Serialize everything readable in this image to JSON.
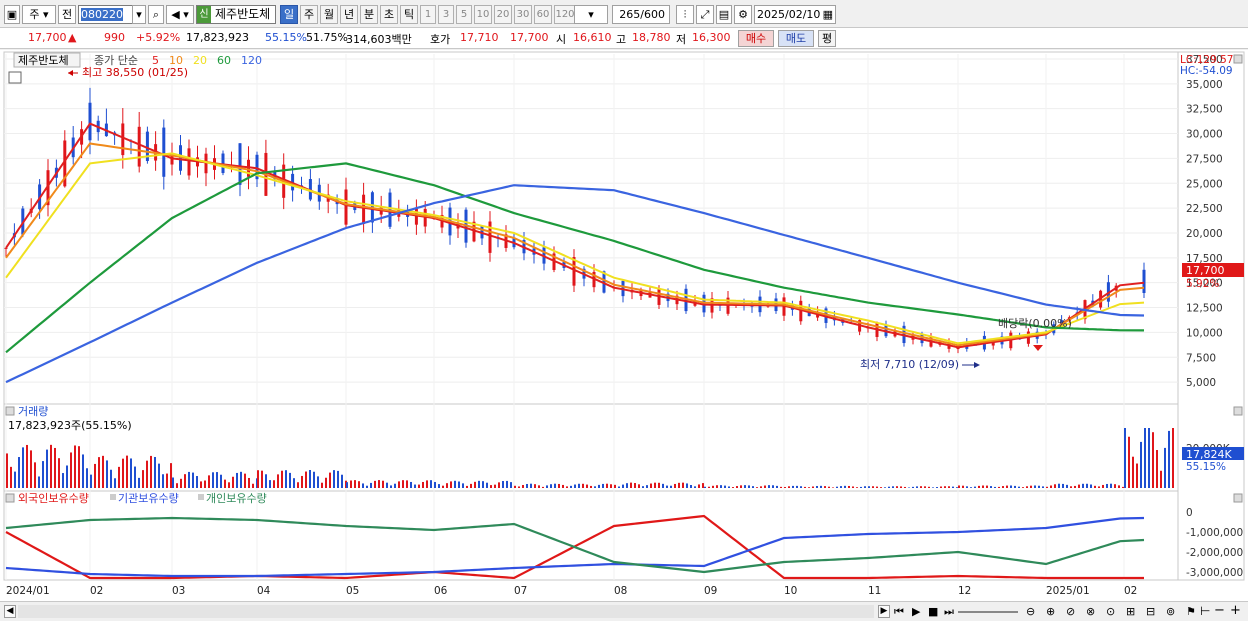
{
  "toolbar": {
    "market": "주",
    "prev": "전",
    "code": "080220",
    "new_badge": "신",
    "stock_name": "제주반도체",
    "periods": [
      "일",
      "주",
      "월",
      "년",
      "분",
      "초",
      "틱"
    ],
    "selected_period": "일",
    "intervals": [
      "1",
      "3",
      "5",
      "10",
      "20",
      "30",
      "60",
      "120"
    ],
    "count": "265",
    "count_total": "/600",
    "date": "2025/02/10"
  },
  "quote": {
    "price": "17,700",
    "change_arrow": "▲",
    "change": "990",
    "change_pct": "+5.92%",
    "volume": "17,823,923",
    "vol_ratio": "55.15%",
    "turnover": "51.75%",
    "amount": "314,603백만",
    "bid_label": "호가",
    "bid1": "17,710",
    "bid2": "17,700",
    "open_label": "시",
    "open": "16,610",
    "high_label": "고",
    "high": "18,780",
    "low_label": "저",
    "low": "16,300",
    "buy_label": "매수",
    "sell_label": "매도",
    "extra_label": "평"
  },
  "colors": {
    "up": "#e0161b",
    "down": "#1f4fd1",
    "ma5": "#e02020",
    "ma10": "#f08a1a",
    "ma20": "#f0e020",
    "ma60": "#1e9a3c",
    "ma120": "#3a64e0",
    "foreign": "#e01818",
    "institution": "#3050e0",
    "individual": "#2f8a5a"
  },
  "price_panel": {
    "title": "제주반도체",
    "legend_prefix": "종가 단순",
    "ma_labels": [
      "5",
      "10",
      "20",
      "60",
      "120"
    ],
    "lc_label": "LC:129.57",
    "hc_label": "HC:-54.09",
    "high_note": "최고 38,550 (01/25)",
    "low_note": "최저 7,710 (12/09)",
    "dividend_note": "배당락(0.00%)",
    "last_price_label": "17,700",
    "last_pct_label": "5.92%"
  },
  "volume_panel": {
    "title": "거래량",
    "value_label": "17,823,923주(55.15%)",
    "axis_label": "20,000K",
    "last_label": "17,824K",
    "last_pct": "55.15%"
  },
  "holdings_panel": {
    "labels": [
      "외국인보유수량",
      "기관보유수량",
      "개인보유수량"
    ]
  },
  "chart_data": [
    {
      "type": "line",
      "title": "제주반도체",
      "x": [
        "2024/01",
        "02",
        "03",
        "04",
        "05",
        "06",
        "07",
        "08",
        "09",
        "10",
        "11",
        "12",
        "2025/01",
        "02"
      ],
      "ylim": [
        3000,
        38000
      ],
      "yticks": [
        "5,000",
        "7,500",
        "10,000",
        "12,500",
        "15,000",
        "17,500",
        "20,000",
        "22,500",
        "25,000",
        "27,500",
        "30,000",
        "32,500",
        "35,000",
        "37,500"
      ],
      "series": [
        {
          "name": "5",
          "values": [
            18500,
            31000,
            27500,
            26500,
            22800,
            21500,
            19000,
            14500,
            12800,
            12700,
            10500,
            8500,
            9800,
            15000
          ]
        },
        {
          "name": "10",
          "values": [
            17500,
            29000,
            27800,
            26200,
            22900,
            21600,
            19500,
            14800,
            13000,
            12800,
            10800,
            8700,
            9900,
            14500
          ]
        },
        {
          "name": "20",
          "values": [
            15500,
            27000,
            28000,
            25800,
            23200,
            21800,
            20000,
            15500,
            13300,
            13000,
            11200,
            8900,
            10000,
            13000
          ]
        },
        {
          "name": "60",
          "values": [
            8000,
            15000,
            21500,
            26000,
            27000,
            24800,
            22000,
            19200,
            16300,
            14500,
            13000,
            11800,
            10500,
            10200
          ]
        },
        {
          "name": "120",
          "values": [
            5000,
            9000,
            13000,
            17000,
            20500,
            23000,
            24800,
            24300,
            22000,
            19800,
            17500,
            15000,
            12800,
            11700
          ]
        }
      ],
      "annotations": [
        {
          "text": "최고 38,550 (01/25)",
          "x": "2024/01",
          "y": 38550
        },
        {
          "text": "최저 7,710 (12/09)",
          "x": "12",
          "y": 7710
        },
        {
          "text": "배당락(0.00%)",
          "x": "12",
          "y": 13000
        }
      ]
    },
    {
      "type": "bar",
      "title": "거래량",
      "x": [
        "2024/01",
        "02",
        "03",
        "04",
        "05",
        "06",
        "07",
        "08",
        "09",
        "10",
        "11",
        "12",
        "2025/01",
        "02"
      ],
      "values_k": [
        12000,
        9000,
        4500,
        5000,
        2200,
        2000,
        1200,
        1500,
        800,
        600,
        500,
        700,
        1200,
        17824
      ]
    },
    {
      "type": "line",
      "title": "외국인보유수량 / 기관보유수량 / 개인보유수량",
      "x": [
        "2024/01",
        "02",
        "03",
        "04",
        "05",
        "06",
        "07",
        "08",
        "09",
        "10",
        "11",
        "12",
        "2025/01",
        "02"
      ],
      "ylim": [
        -3300000,
        300000
      ],
      "yticks": [
        "0",
        "-1,000,000",
        "-2,000,000",
        "-3,000,000"
      ],
      "series": [
        {
          "name": "외국인보유수량",
          "values": [
            -1000000,
            -3300000,
            -3300000,
            -3200000,
            -3300000,
            -3000000,
            -3300000,
            -700000,
            -200000,
            -3300000,
            -3300000,
            -3200000,
            -3300000,
            -3300000
          ]
        },
        {
          "name": "기관보유수량",
          "values": [
            -2800000,
            -3100000,
            -3200000,
            -3200000,
            -3100000,
            -3000000,
            -2800000,
            -2600000,
            -2700000,
            -1300000,
            -1100000,
            -1000000,
            -800000,
            -300000
          ]
        },
        {
          "name": "개인보유수량",
          "values": [
            -800000,
            -400000,
            -300000,
            -400000,
            -700000,
            -900000,
            -600000,
            -2500000,
            -3000000,
            -2500000,
            -2300000,
            -2000000,
            -2600000,
            -1400000
          ]
        }
      ]
    }
  ]
}
